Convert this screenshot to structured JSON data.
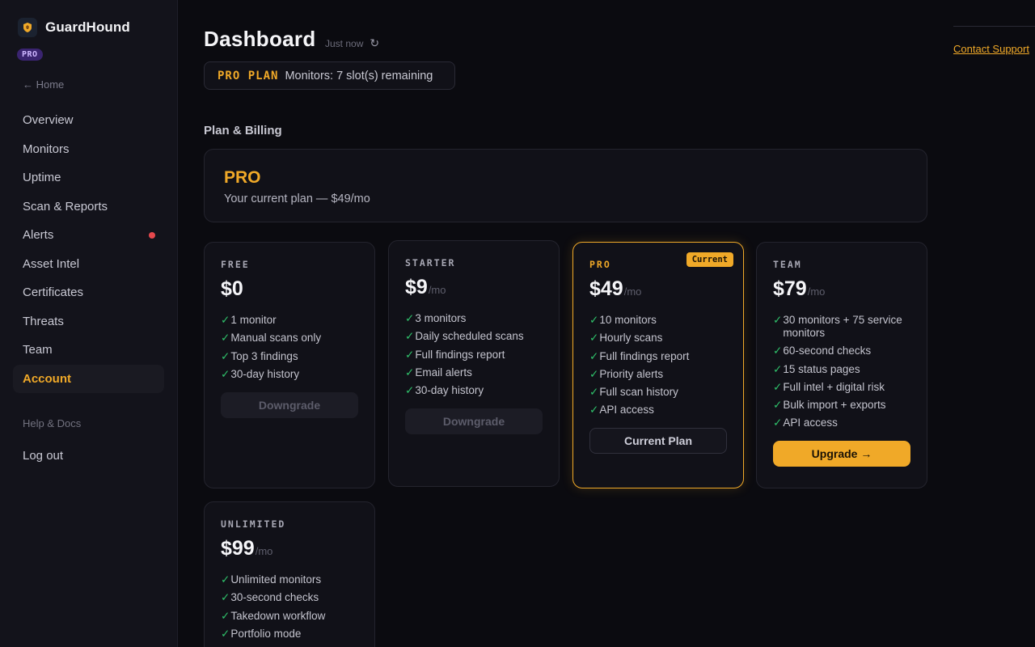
{
  "app": {
    "name": "GuardHound",
    "plan_badge": "PRO"
  },
  "sidebar": {
    "home_link": "← Home",
    "items": [
      {
        "label": "Overview"
      },
      {
        "label": "Monitors"
      },
      {
        "label": "Uptime"
      },
      {
        "label": "Scan & Reports"
      },
      {
        "label": "Alerts",
        "has_alert_dot": true
      },
      {
        "label": "Asset Intel"
      },
      {
        "label": "Certificates"
      },
      {
        "label": "Threats"
      },
      {
        "label": "Team"
      },
      {
        "label": "Account",
        "active": true
      }
    ],
    "help": "Help & Docs",
    "logout": "Log out"
  },
  "header": {
    "title": "Dashboard",
    "updated": "Just now",
    "refresh_icon": "↻",
    "plan_tag": "PRO PLAN",
    "plan_status": "Monitors: 7 slot(s) remaining",
    "contact": "Contact Support"
  },
  "billing": {
    "section_title": "Plan & Billing",
    "current_plan_name": "PRO",
    "current_plan_desc": "Your current plan — $49/mo"
  },
  "plans": [
    {
      "label": "FREE",
      "price": "$0",
      "per": "",
      "features": [
        "1 monitor",
        "Manual scans only",
        "Top 3 findings",
        "30-day history"
      ],
      "button": "Downgrade"
    },
    {
      "label": "STARTER",
      "price": "$9",
      "per": "/mo",
      "features": [
        "3 monitors",
        "Daily scheduled scans",
        "Full findings report",
        "Email alerts",
        "30-day history"
      ],
      "button": "Downgrade"
    },
    {
      "label": "PRO",
      "price": "$49",
      "per": "/mo",
      "current_tag": "Current",
      "features": [
        "10 monitors",
        "Hourly scans",
        "Full findings report",
        "Priority alerts",
        "Full scan history",
        "API access"
      ],
      "button": "Current Plan"
    },
    {
      "label": "TEAM",
      "price": "$79",
      "per": "/mo",
      "features": [
        "30 monitors + 75 service monitors",
        "60-second checks",
        "15 status pages",
        "Full intel + digital risk",
        "Bulk import + exports",
        "API access"
      ],
      "button": "Upgrade →"
    },
    {
      "label": "UNLIMITED",
      "price": "$99",
      "per": "/mo",
      "features": [
        "Unlimited monitors",
        "30-second checks",
        "Takedown workflow",
        "Portfolio mode"
      ],
      "button": ""
    }
  ],
  "check_glyph": "✓",
  "colors": {
    "accent": "#f0a928",
    "check": "#2fc06a",
    "alert_dot": "#e5484d",
    "background": "#0b0b10"
  }
}
